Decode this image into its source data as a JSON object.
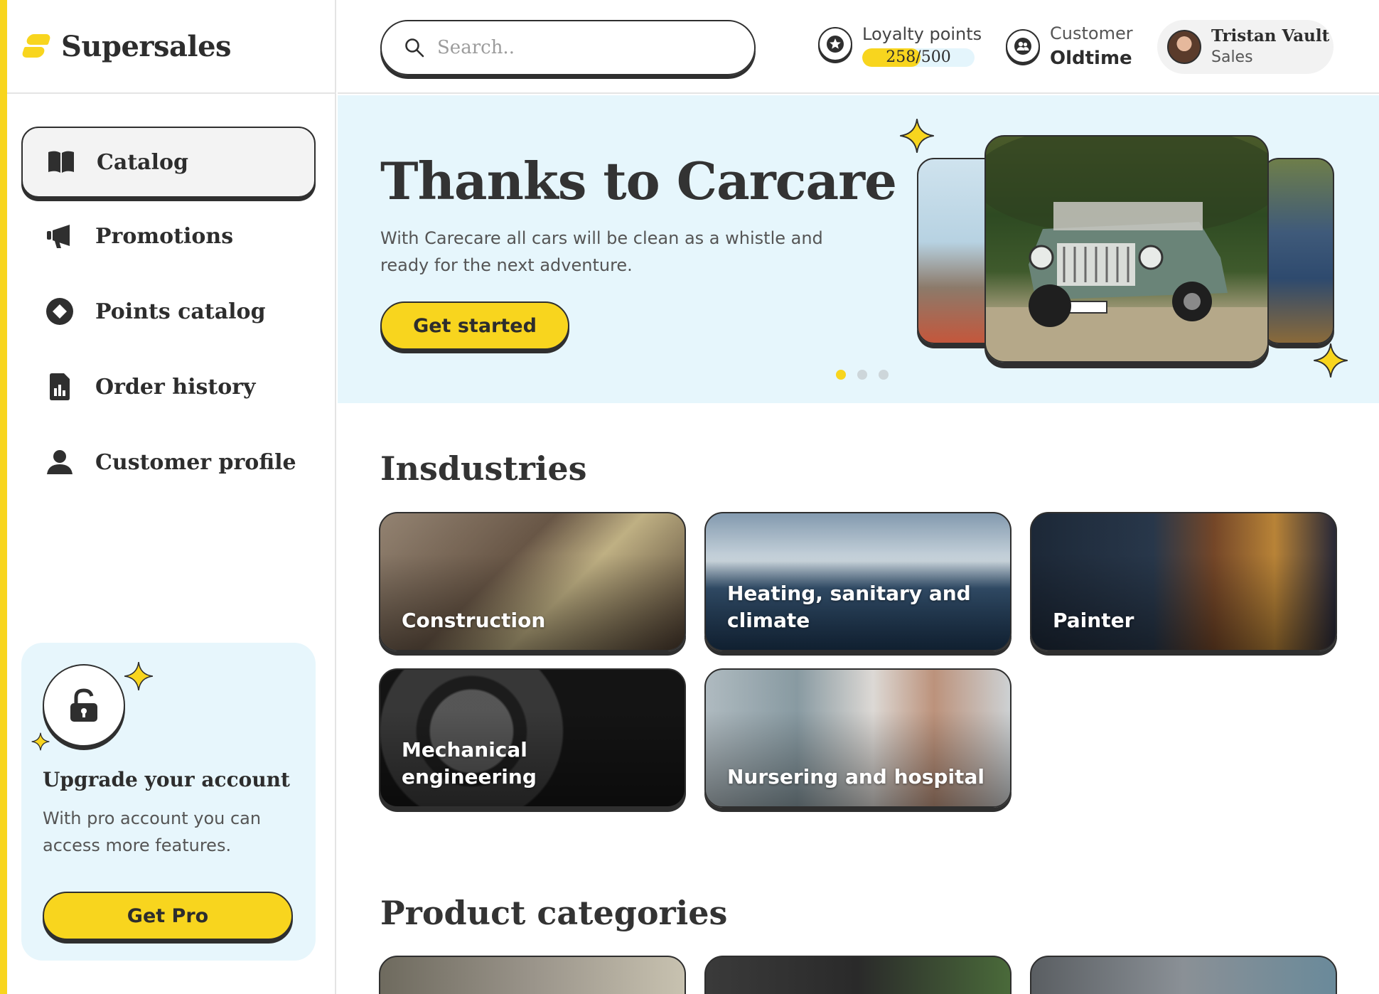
{
  "app": {
    "brand": "Supersales",
    "accent_color": "#f8d51e"
  },
  "sidebar": {
    "items": [
      {
        "label": "Catalog",
        "icon": "book-icon",
        "active": true
      },
      {
        "label": "Promotions",
        "icon": "megaphone-icon",
        "active": false
      },
      {
        "label": "Points catalog",
        "icon": "diamond-icon",
        "active": false
      },
      {
        "label": "Order history",
        "icon": "report-icon",
        "active": false
      },
      {
        "label": "Customer profile",
        "icon": "user-icon",
        "active": false
      }
    ],
    "upgrade": {
      "title": "Upgrade your account",
      "text": "With pro account you can access more features.",
      "button": "Get Pro",
      "icon": "lock-icon"
    }
  },
  "header": {
    "search_placeholder": "Search..",
    "loyalty": {
      "label": "Loyalty points",
      "value": "258/500",
      "current": 258,
      "max": 500,
      "icon": "star-icon"
    },
    "customer": {
      "label": "Customer",
      "value": "Oldtime",
      "icon": "users-icon"
    },
    "user": {
      "name": "Tristan Vault",
      "role": "Sales"
    }
  },
  "hero": {
    "title": "Thanks to Carcare",
    "text": "With Carecare all cars will be clean as a whistle and ready for the next adventure.",
    "button": "Get started",
    "slides": 3,
    "active_slide": 1
  },
  "industries": {
    "title": "Insdustries",
    "cards": [
      {
        "label": "Construction"
      },
      {
        "label": "Heating, sanitary and climate"
      },
      {
        "label": "Painter"
      },
      {
        "label": "Mechanical engineering"
      },
      {
        "label": "Nursering and hospital"
      }
    ]
  },
  "product_categories": {
    "title": "Product categories"
  }
}
